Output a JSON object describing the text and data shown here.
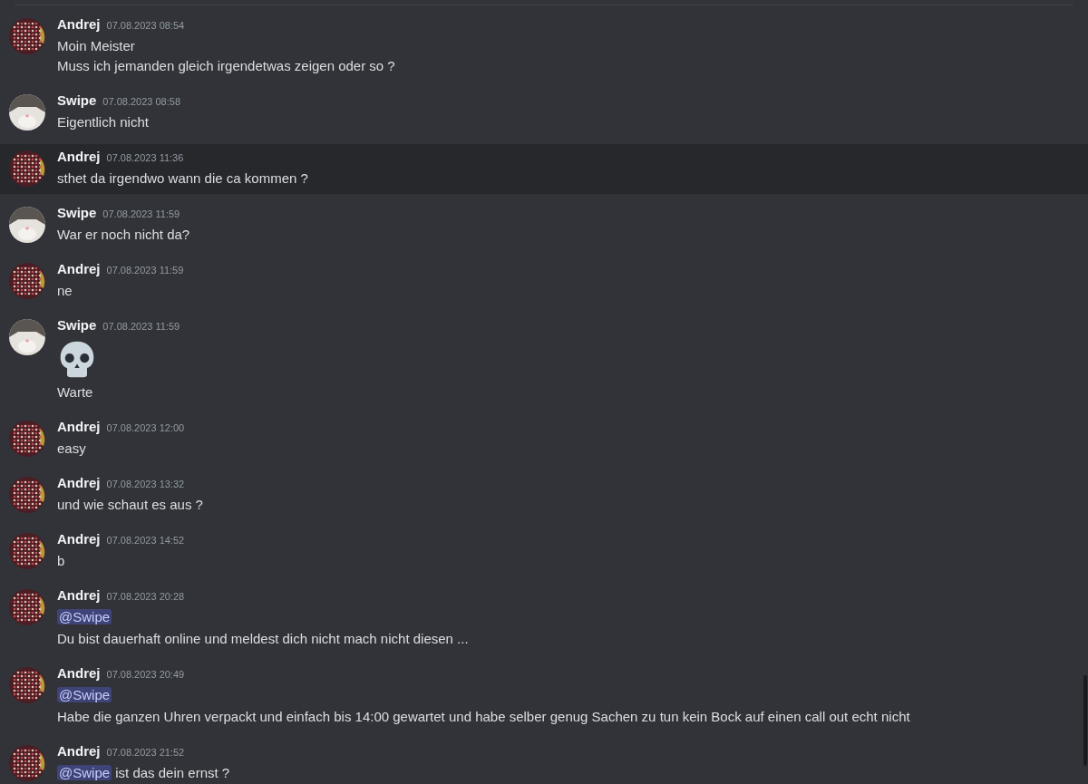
{
  "messages": [
    {
      "author": "Andrej",
      "avatar": {
        "kind": "pattern"
      },
      "time": "07.08.2023 08:54",
      "highlighted": false,
      "lines": [
        [
          {
            "kind": "text",
            "text": "Moin Meister"
          }
        ],
        [
          {
            "kind": "text",
            "text": "Muss ich jemanden gleich irgendetwas zeigen oder so ?"
          }
        ]
      ]
    },
    {
      "author": "Swipe",
      "avatar": {
        "kind": "animal"
      },
      "time": "07.08.2023 08:58",
      "highlighted": false,
      "lines": [
        [
          {
            "kind": "text",
            "text": "Eigentlich nicht"
          }
        ]
      ]
    },
    {
      "author": "Andrej",
      "avatar": {
        "kind": "pattern"
      },
      "time": "07.08.2023 11:36",
      "highlighted": true,
      "lines": [
        [
          {
            "kind": "text",
            "text": "sthet da irgendwo wann die ca kommen ?"
          }
        ]
      ]
    },
    {
      "author": "Swipe",
      "avatar": {
        "kind": "animal"
      },
      "time": "07.08.2023 11:59",
      "highlighted": false,
      "lines": [
        [
          {
            "kind": "text",
            "text": "War er noch nicht da?"
          }
        ]
      ]
    },
    {
      "author": "Andrej",
      "avatar": {
        "kind": "pattern"
      },
      "time": "07.08.2023 11:59",
      "highlighted": false,
      "lines": [
        [
          {
            "kind": "text",
            "text": "ne"
          }
        ]
      ]
    },
    {
      "author": "Swipe",
      "avatar": {
        "kind": "animal"
      },
      "time": "07.08.2023 11:59",
      "highlighted": false,
      "lines": [
        [
          {
            "kind": "emoji"
          }
        ],
        [
          {
            "kind": "text",
            "text": "Warte"
          }
        ]
      ]
    },
    {
      "author": "Andrej",
      "avatar": {
        "kind": "pattern"
      },
      "time": "07.08.2023 12:00",
      "highlighted": false,
      "lines": [
        [
          {
            "kind": "text",
            "text": "easy"
          }
        ]
      ]
    },
    {
      "author": "Andrej",
      "avatar": {
        "kind": "pattern"
      },
      "time": "07.08.2023 13:32",
      "highlighted": false,
      "lines": [
        [
          {
            "kind": "text",
            "text": "und wie schaut es aus ?"
          }
        ]
      ]
    },
    {
      "author": "Andrej",
      "avatar": {
        "kind": "pattern"
      },
      "time": "07.08.2023 14:52",
      "highlighted": false,
      "lines": [
        [
          {
            "kind": "text",
            "text": "b"
          }
        ]
      ]
    },
    {
      "author": "Andrej",
      "avatar": {
        "kind": "pattern"
      },
      "time": "07.08.2023 20:28",
      "highlighted": false,
      "lines": [
        [
          {
            "kind": "mention",
            "text": "@Swipe"
          }
        ],
        [
          {
            "kind": "text",
            "text": "Du bist dauerhaft online und meldest dich nicht mach nicht diesen ..."
          }
        ]
      ]
    },
    {
      "author": "Andrej",
      "avatar": {
        "kind": "pattern"
      },
      "time": "07.08.2023 20:49",
      "highlighted": false,
      "lines": [
        [
          {
            "kind": "mention",
            "text": "@Swipe"
          }
        ],
        [
          {
            "kind": "text",
            "text": "Habe die ganzen Uhren verpackt und einfach bis 14:00 gewartet und habe selber genug Sachen zu tun kein Bock auf einen call out echt nicht"
          }
        ]
      ]
    },
    {
      "author": "Andrej",
      "avatar": {
        "kind": "pattern"
      },
      "time": "07.08.2023 21:52",
      "highlighted": false,
      "lines": [
        [
          {
            "kind": "mention",
            "text": "@Swipe"
          },
          {
            "kind": "text",
            "text": " ist das dein ernst ?"
          }
        ]
      ]
    }
  ]
}
